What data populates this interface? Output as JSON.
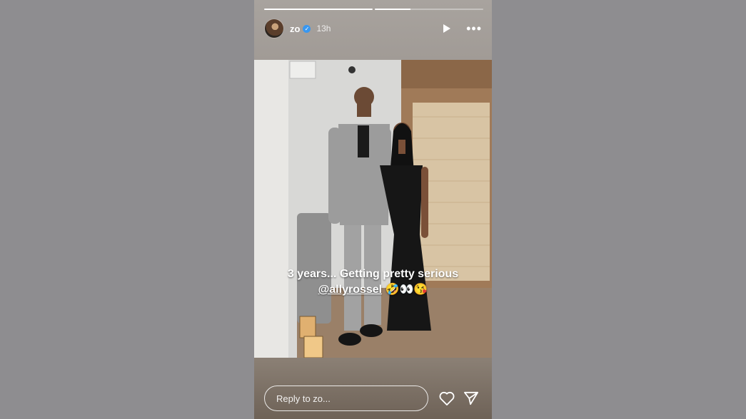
{
  "story": {
    "progress": [
      1,
      0.33
    ],
    "username": "zo",
    "time": "13h",
    "caption_line1": "3 years... Getting pretty serious",
    "mention": "@allyrossel",
    "emojis": "🤣👀😘",
    "reply_placeholder": "Reply to zo..."
  },
  "colors": {
    "background": "#8e8d90",
    "verified": "#3897f0"
  }
}
